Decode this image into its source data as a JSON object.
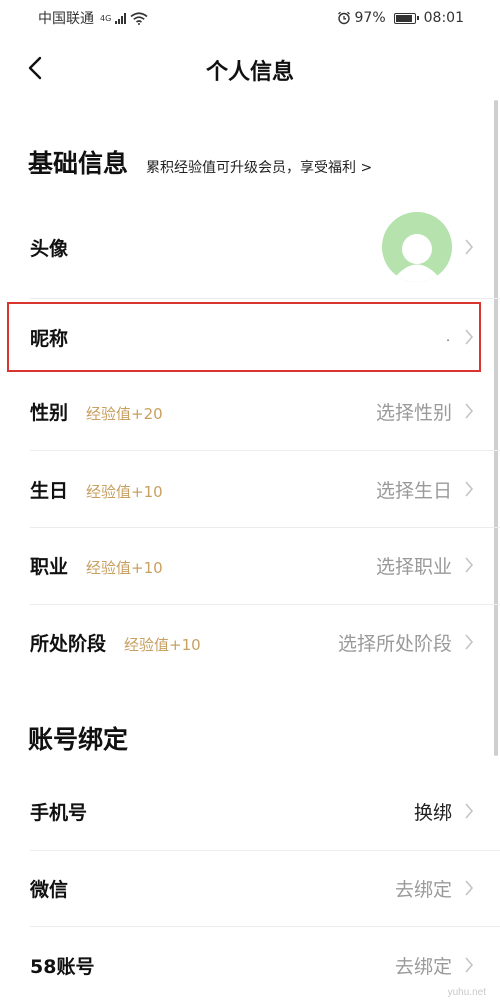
{
  "status_bar": {
    "carrier": "中国联通",
    "network": "4G",
    "battery": "97%",
    "battery_level": 0.97,
    "time": "08:01"
  },
  "nav": {
    "title": "个人信息"
  },
  "basic_section": {
    "title": "基础信息",
    "subtitle": "累积经验值可升级会员，享受福利 >"
  },
  "rows": {
    "avatar": {
      "label": "头像"
    },
    "nickname": {
      "label": "昵称",
      "value": "."
    },
    "gender": {
      "label": "性别",
      "badge": "经验值+20",
      "value": "选择性别"
    },
    "birthday": {
      "label": "生日",
      "badge": "经验值+10",
      "value": "选择生日"
    },
    "job": {
      "label": "职业",
      "badge": "经验值+10",
      "value": "选择职业"
    },
    "stage": {
      "label": "所处阶段",
      "badge": "经验值+10",
      "value": "选择所处阶段"
    }
  },
  "account_section": {
    "title": "账号绑定"
  },
  "account_rows": {
    "phone": {
      "label": "手机号",
      "value": "换绑"
    },
    "wechat": {
      "label": "微信",
      "value": "去绑定"
    },
    "account58": {
      "label": "58账号",
      "value": "去绑定"
    }
  },
  "watermark": "yuhu.net"
}
